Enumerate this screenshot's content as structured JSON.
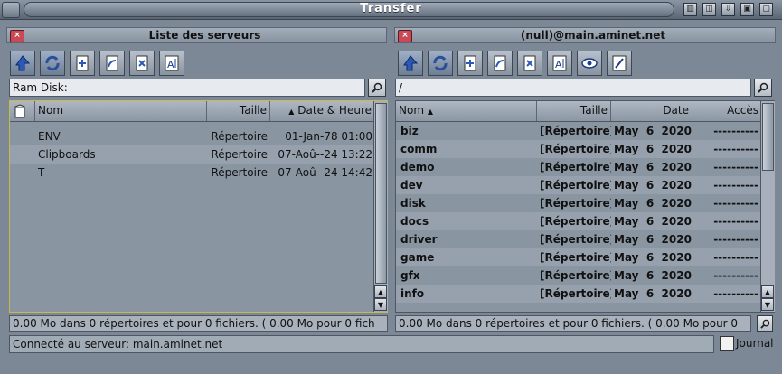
{
  "window": {
    "title": "Transfer",
    "titlebar_buttons": [
      "iconify",
      "snapshot",
      "jump",
      "depth",
      "zoom"
    ]
  },
  "colors": {
    "close_button": "#c94a55",
    "pathbar_bg": "#e7eaee",
    "panel_bg": "#7b8694"
  },
  "left": {
    "title": "Liste des serveurs",
    "path": "Ram Disk:",
    "toolbar": [
      "parent-icon",
      "refresh-icon",
      "new-icon",
      "rename-icon",
      "delete-icon",
      "edit-text-icon"
    ],
    "columns": {
      "name": "Nom",
      "size": "Taille",
      "date": "Date & Heure",
      "date_sort": "▲"
    },
    "rows": [
      {
        "name": "ENV",
        "size": "Répertoire",
        "date": "01-Jan-78 01:00"
      },
      {
        "name": "Clipboards",
        "size": "Répertoire",
        "date": "07-Aoû--24 13:22"
      },
      {
        "name": "T",
        "size": "Répertoire",
        "date": "07-Aoû--24 14:42"
      }
    ],
    "status": "0.00 Mo dans 0 répertoires et pour 0 fichiers. ( 0.00 Mo pour 0 fich"
  },
  "right": {
    "title": "(null)@main.aminet.net",
    "path": "/",
    "toolbar": [
      "parent-icon",
      "refresh-icon",
      "new-icon",
      "rename-icon",
      "delete-icon",
      "edit-text-icon",
      "view-icon",
      "edit-icon"
    ],
    "columns": {
      "name": "Nom",
      "name_sort": "▲",
      "size": "Taille",
      "date": "Date",
      "access": "Accès"
    },
    "rows": [
      {
        "name": "biz",
        "size": "[Répertoire]",
        "date": "May  6  2020",
        "access": "----------"
      },
      {
        "name": "comm",
        "size": "[Répertoire]",
        "date": "May  6  2020",
        "access": "----------"
      },
      {
        "name": "demo",
        "size": "[Répertoire]",
        "date": "May  6  2020",
        "access": "----------"
      },
      {
        "name": "dev",
        "size": "[Répertoire]",
        "date": "May  6  2020",
        "access": "----------"
      },
      {
        "name": "disk",
        "size": "[Répertoire]",
        "date": "May  6  2020",
        "access": "----------"
      },
      {
        "name": "docs",
        "size": "[Répertoire]",
        "date": "May  6  2020",
        "access": "----------"
      },
      {
        "name": "driver",
        "size": "[Répertoire]",
        "date": "May  6  2020",
        "access": "----------"
      },
      {
        "name": "game",
        "size": "[Répertoire]",
        "date": "May  6  2020",
        "access": "----------"
      },
      {
        "name": "gfx",
        "size": "[Répertoire]",
        "date": "May  6  2020",
        "access": "----------"
      },
      {
        "name": "info",
        "size": "[Répertoire]",
        "date": "May  6  2020",
        "access": "----------"
      }
    ],
    "status": "0.00 Mo dans 0 répertoires et pour 0 fichiers. ( 0.00 Mo pour 0"
  },
  "footer": {
    "connection": "Connecté au serveur: main.aminet.net",
    "journal_label": "Journal",
    "journal_checked": false
  }
}
